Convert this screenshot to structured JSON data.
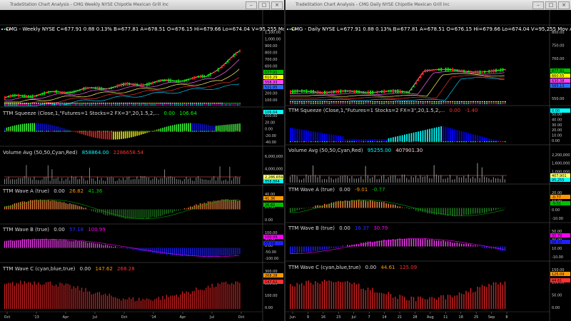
{
  "left": {
    "title": "TradeStation Chart Analysis - CMG Weekly NYSE Chipotle Mexican Grill Inc",
    "header": {
      "symbol": "CMG - Weekly",
      "exchange": "NYSE",
      "last": "C=677.91",
      "chg": "0.88",
      "pct": "0.13%",
      "bid": "B=677.81",
      "ask": "A=678.51",
      "open": "O=676.15",
      "high": "Hi=679.66",
      "low": "Lo=674.04",
      "vol": "V=95,255",
      "study": "Mov Avg Exp"
    },
    "price_ticks": [
      "1,100.00",
      "1,000.00",
      "900.00",
      "800.00",
      "700.00",
      "600.00",
      "500.00",
      "400.00",
      "300.00",
      "200.00",
      "100.00"
    ],
    "price_tags": [
      "677.91",
      "610.29",
      "558.33",
      "521.95"
    ],
    "squeeze": {
      "label": "TTM Squeeze (Close,1,\"Futures=1 Stocks=2 FX=3\",20,1.5,2,...",
      "v1": "0.00",
      "v2": "106.64",
      "ticks": [
        "100.00",
        "20.00",
        "0.00",
        "-20.00",
        "-40.00"
      ],
      "tag": "106.64"
    },
    "volume": {
      "label": "Volume Avg (50,50,Cyan,Red)",
      "v1": "858864.00",
      "v2": "2286658.54",
      "ticks": [
        "6,000,000",
        "4,000,000",
        "2,000,000"
      ],
      "tags": [
        "2,286,659",
        "858,864"
      ]
    },
    "wave_a": {
      "label": "TTM Wave A (true)",
      "v1": "0.00",
      "v2": "26.82",
      "v3": "41.36",
      "ticks": [
        "40.00",
        "20.00",
        "0.00"
      ],
      "tags": [
        "41.36",
        "26.82"
      ]
    },
    "wave_b": {
      "label": "TTM Wave B (true)",
      "v1": "0.00",
      "v2": "57.18",
      "v3": "100.99",
      "ticks": [
        "100.00",
        "50.00",
        "0.00",
        "-50.00",
        "-100.00"
      ],
      "tags": [
        "100.99",
        "57.18"
      ]
    },
    "wave_c": {
      "label": "TTM Wave C (cyan,blue,true)",
      "v1": "0.00",
      "v2": "147.62",
      "v3": "268.28",
      "ticks": [
        "300.00",
        "200.00",
        "100.00",
        "0.00"
      ],
      "tags": [
        "268.28",
        "147.62"
      ]
    },
    "xaxis": [
      "Oct",
      "'13",
      "Apr",
      "Jul",
      "Oct",
      "'14",
      "Apr",
      "Jul",
      "Oct"
    ]
  },
  "right": {
    "title": "TradeStation Chart Analysis - CMG Daily NYSE Chipotle Mexican Grill Inc",
    "header": {
      "symbol": "CMG - Daily",
      "exchange": "NYSE",
      "last": "L=677.91",
      "chg": "0.88",
      "pct": "0.13%",
      "bid": "B=677.81",
      "ask": "A=678.51",
      "open": "O=676.15",
      "high": "Hi=679.66",
      "low": "Lo=674.04",
      "vol": "V=95,255",
      "study": "Mov Avg Exp"
    },
    "price_ticks": [
      "800.00",
      "750.00",
      "700.00",
      "650.00",
      "600.00",
      "550.00"
    ],
    "price_tags": [
      "677.91",
      "660.55",
      "630.38",
      "585.13"
    ],
    "squeeze": {
      "label": "TTM Squeeze (Close,1,\"Futures=1 Stocks=2 FX=3\",20,1.5,2,...",
      "v1": "0.00",
      "v2": "-1.40",
      "ticks": [
        "50.00",
        "40.00",
        "30.00",
        "20.00",
        "10.00",
        "0.00"
      ],
      "tag": "0.00"
    },
    "volume": {
      "label": "Volume Avg (50,50,Cyan,Red)",
      "v1": "95255.00",
      "v2": "407901.30",
      "ticks": [
        "2,200,000",
        "1,600,000",
        "1,000,000",
        "600,000"
      ],
      "tags": [
        "407,901",
        "95,255"
      ]
    },
    "wave_a": {
      "label": "TTM Wave A (true)",
      "v1": "0.00",
      "v2": "-9.01",
      "v3": "-0.77",
      "ticks": [
        "20.00",
        "10.00",
        "0.00",
        "-10.00"
      ],
      "tags": [
        "-0.77",
        "-9.01"
      ]
    },
    "wave_b": {
      "label": "TTM Wave B (true)",
      "v1": "0.00",
      "v2": "16.37",
      "v3": "30.79",
      "ticks": [
        "50.00",
        "30.00",
        "10.00",
        "-10.00"
      ],
      "tags": [
        "30.79",
        "16.37"
      ]
    },
    "wave_c": {
      "label": "TTM Wave C (cyan,blue,true)",
      "v1": "0.00",
      "v2": "44.61",
      "v3": "125.09",
      "ticks": [
        "150.00",
        "100.00",
        "50.00",
        "0.00"
      ],
      "tags": [
        "125.09",
        "44.61"
      ]
    },
    "xaxis": [
      "Jun",
      "9",
      "16",
      "23",
      "Jul",
      "7",
      "14",
      "21",
      "28",
      "Aug",
      "11",
      "18",
      "25",
      "Sep",
      "8"
    ]
  },
  "colors": {
    "green": "#00d000",
    "red": "#ff3030",
    "cyan": "#00ffff",
    "blue": "#2020ff",
    "magenta": "#ff00ff",
    "yellow": "#ffff00",
    "orange": "#ff9900"
  }
}
